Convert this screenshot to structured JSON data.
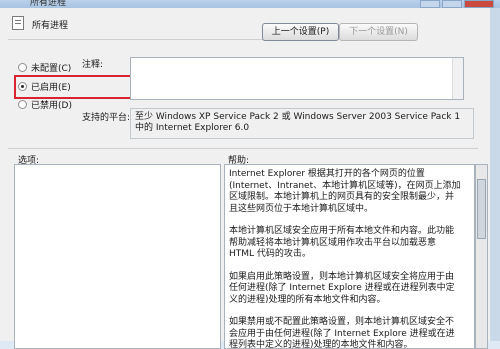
{
  "window": {
    "title": "所有进程"
  },
  "policy": {
    "name": "所有进程"
  },
  "buttons": {
    "prev": "上一个设置(P)",
    "next": "下一个设置(N)"
  },
  "radios": [
    {
      "label": "未配置(C)",
      "checked": false
    },
    {
      "label": "已启用(E)",
      "checked": true
    },
    {
      "label": "已禁用(D)",
      "checked": false
    }
  ],
  "labels": {
    "comment": "注释:",
    "supported": "支持的平台:",
    "options": "选项:",
    "help": "帮助:"
  },
  "comment": {
    "value": ""
  },
  "supported": {
    "text": "至少 Windows XP Service Pack 2 或 Windows Server 2003 Service Pack 1中的 Internet Explorer 6.0"
  },
  "help": {
    "paragraphs": [
      "Internet Explorer 根据其打开的各个网页的位置(Internet、Intranet、本地计算机区域等)，在网页上添加区域限制。本地计算机上的网页具有的安全限制最少，并且这些网页位于本地计算机区域中。",
      "本地计算机区域安全应用于所有本地文件和内容。此功能帮助减轻将本地计算机区域用作攻击平台以加载恶意 HTML 代码的攻击。",
      "如果启用此策略设置，则本地计算机区域安全将应用于由任何进程(除了 Internet Explore 进程或在进程列表中定义的进程)处理的所有本地文件和内容。",
      "如果禁用或不配置此策略设置，则本地计算机区域安全不会应用于由任何进程(除了 Internet Explore 进程或在进程列表中定义的进程)处理的本地文件和内容。"
    ]
  },
  "colors": {
    "highlight": "#d8242f"
  }
}
